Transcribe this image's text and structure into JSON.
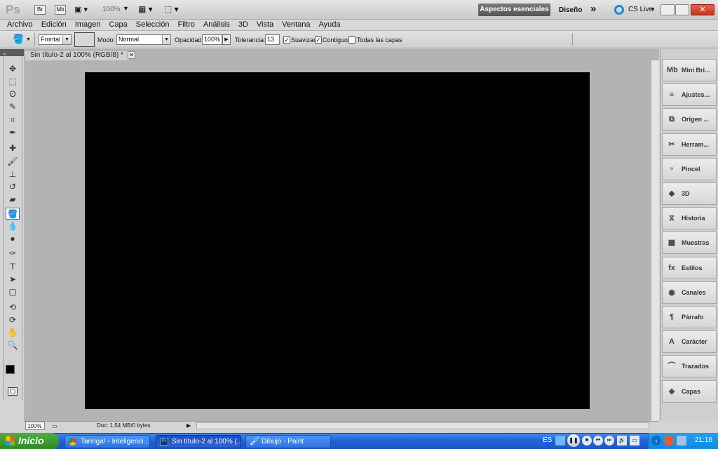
{
  "app": {
    "logo": "Ps",
    "zoom": "100%",
    "workspace": "Aspectos esenciales",
    "design": "Diseño",
    "more": "»",
    "cslive": "CS Live"
  },
  "menu": [
    "Archivo",
    "Edición",
    "Imagen",
    "Capa",
    "Selección",
    "Filtro",
    "Análisis",
    "3D",
    "Vista",
    "Ventana",
    "Ayuda"
  ],
  "options": {
    "fill_source": "Frontal",
    "mode_label": "Modo:",
    "mode_value": "Normal",
    "opacity_label": "Opacidad:",
    "opacity_value": "100%",
    "tolerance_label": "Tolerancia:",
    "tolerance_value": "13",
    "antialias_label": "Suavizar",
    "contiguous_label": "Contiguo",
    "all_layers_label": "Todas las capas",
    "antialias_checked": true,
    "contiguous_checked": true,
    "all_layers_checked": false
  },
  "document": {
    "tab_title": "Sin título-2 al 100% (RGB/8) *",
    "canvas_color": "#000000"
  },
  "tools": [
    "move-icon",
    "marquee-icon",
    "lasso-icon",
    "quick-select-icon",
    "crop-icon",
    "eyedropper-icon",
    "healing-icon",
    "brush-icon",
    "stamp-icon",
    "history-brush-icon",
    "eraser-icon",
    "paint-bucket-icon",
    "blur-icon",
    "dodge-icon",
    "pen-icon",
    "type-icon",
    "path-select-icon",
    "shape-icon",
    "3d-rotate-icon",
    "3d-orbit-icon",
    "hand-icon",
    "zoom-icon"
  ],
  "panels": [
    {
      "label": "Mini Bri...",
      "icon": "mini-bridge-icon"
    },
    {
      "label": "Ajustes...",
      "icon": "adjustments-icon"
    },
    {
      "label": "Origen ...",
      "icon": "clone-source-icon"
    },
    {
      "label": "Herram...",
      "icon": "tool-presets-icon"
    },
    {
      "label": "Pincel",
      "icon": "brush-panel-icon"
    },
    {
      "label": "3D",
      "icon": "3d-panel-icon"
    },
    {
      "label": "Historia",
      "icon": "history-icon"
    },
    {
      "label": "Muestras",
      "icon": "swatches-icon"
    },
    {
      "label": "Estilos",
      "icon": "styles-icon"
    },
    {
      "label": "Canales",
      "icon": "channels-icon"
    },
    {
      "label": "Párrafo",
      "icon": "paragraph-icon"
    },
    {
      "label": "Carácter",
      "icon": "character-icon"
    },
    {
      "label": "Trazados",
      "icon": "paths-icon"
    },
    {
      "label": "Capas",
      "icon": "layers-icon"
    }
  ],
  "status": {
    "zoom": "100%",
    "doc": "Doc: 1,54 MB/0 bytes"
  },
  "taskbar": {
    "start": "Inicio",
    "tasks": [
      "Taringa! - Inteligenci...",
      "Sin título-2 al 100% (...",
      "Dibujo - Paint"
    ],
    "lang": "ES",
    "clock": "21:16"
  }
}
